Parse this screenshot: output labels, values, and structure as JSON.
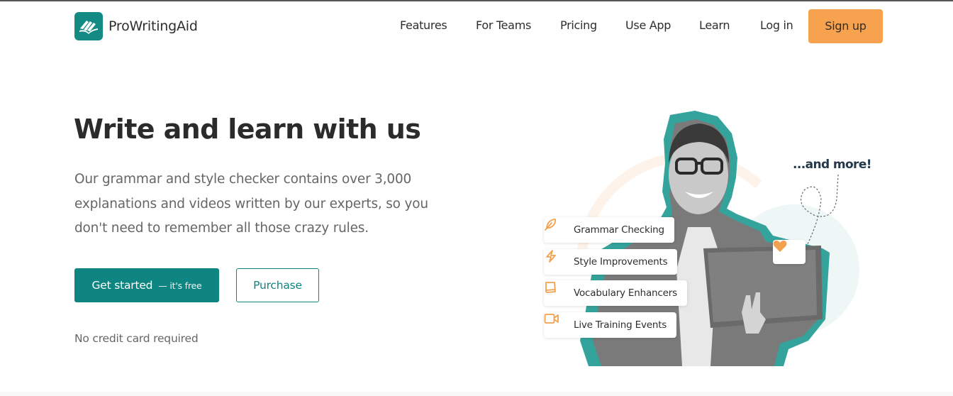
{
  "header": {
    "brand": "ProWritingAid",
    "logo_icon": "book-quill-icon",
    "nav": [
      {
        "label": "Features"
      },
      {
        "label": "For Teams"
      },
      {
        "label": "Pricing"
      },
      {
        "label": "Use App"
      },
      {
        "label": "Learn"
      },
      {
        "label": "Log in"
      }
    ],
    "signup_label": "Sign up"
  },
  "hero": {
    "title": "Write and learn with us",
    "description": "Our grammar and style checker contains over 3,000 explanations and videos written by our experts, so you don't need to remember all those crazy rules.",
    "primary_button": {
      "label": "Get started",
      "sublabel": "— it's free"
    },
    "secondary_button": {
      "label": "Purchase"
    },
    "note": "No credit card required"
  },
  "illustration": {
    "features": [
      {
        "label": "Grammar Checking",
        "icon": "feather-icon"
      },
      {
        "label": "Style Improvements",
        "icon": "lightning-icon"
      },
      {
        "label": "Vocabulary Enhancers",
        "icon": "book-icon"
      },
      {
        "label": "Live Training Events",
        "icon": "video-camera-icon"
      }
    ],
    "more_text": "...and more!",
    "heart_icon": "heart-icon"
  },
  "colors": {
    "brand_teal": "#0e8580",
    "accent_orange": "#f6a24f",
    "text_dark": "#2e2e2e",
    "text_muted": "#666666"
  }
}
